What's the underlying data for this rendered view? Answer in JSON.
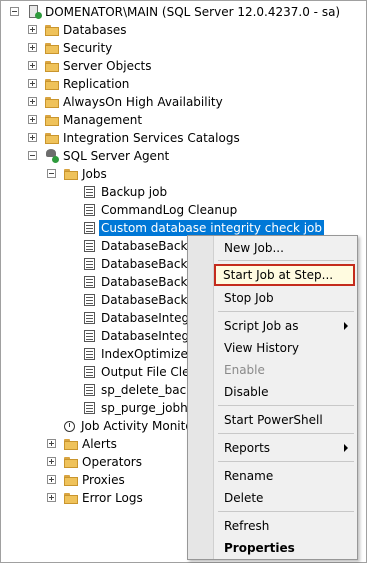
{
  "tree": {
    "server": "DOMENATOR\\MAIN (SQL Server 12.0.4237.0 - sa)",
    "databases": "Databases",
    "security": "Security",
    "server_objects": "Server Objects",
    "replication": "Replication",
    "alwayson": "AlwaysOn High Availability",
    "management": "Management",
    "integration": "Integration Services Catalogs",
    "agent": "SQL Server Agent",
    "jobs": "Jobs",
    "job_items": [
      "Backup job",
      "CommandLog Cleanup",
      "Custom database integrity check job",
      "DatabaseBackup",
      "DatabaseBackup",
      "DatabaseBackup",
      "DatabaseBackup",
      "DatabaseIntegrit",
      "DatabaseIntegrit",
      "IndexOptimize -",
      "Output File Clea",
      "sp_delete_backu",
      "sp_purge_jobhist"
    ],
    "job_activity_monitor": "Job Activity Monitor",
    "alerts": "Alerts",
    "operators": "Operators",
    "proxies": "Proxies",
    "error_logs": "Error Logs"
  },
  "context_menu": {
    "new_job": "New Job...",
    "start_job_at_step": "Start Job at Step...",
    "stop_job": "Stop Job",
    "script_job_as": "Script Job as",
    "view_history": "View History",
    "enable": "Enable",
    "disable": "Disable",
    "start_powershell": "Start PowerShell",
    "reports": "Reports",
    "rename": "Rename",
    "delete": "Delete",
    "refresh": "Refresh",
    "properties": "Properties"
  },
  "colors": {
    "selection": "#0078d7",
    "highlight_border": "#c42b1c"
  }
}
